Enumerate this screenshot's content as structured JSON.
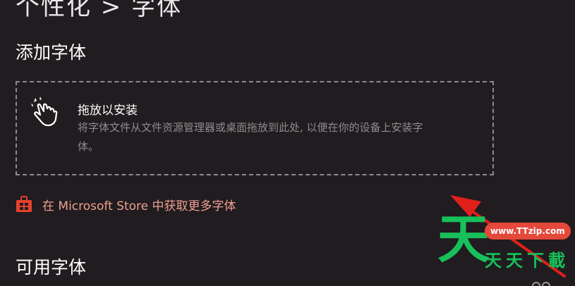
{
  "header": {
    "title": "个性化 > 字体"
  },
  "add_fonts": {
    "heading": "添加字体",
    "drop_zone": {
      "title": "拖放以安装",
      "description": "将字体文件从文件资源管理器或桌面拖放到此处, 以便在你的设备上安装字体。",
      "icon": "drag-hand-icon"
    },
    "store_link": {
      "label": "在 Microsoft Store 中获取更多字体",
      "icon": "store-bag-icon",
      "color": "#f0a090"
    }
  },
  "available_fonts": {
    "heading": "可用字体"
  },
  "watermark": {
    "glyph": "天",
    "url": "www.TTzip.com",
    "name": "天天下載"
  },
  "colors": {
    "background": "#201c1f",
    "accent_link": "#f0a090",
    "arrow": "#e0201c",
    "watermark_green": "#17c05a",
    "watermark_red": "#e4483b"
  }
}
